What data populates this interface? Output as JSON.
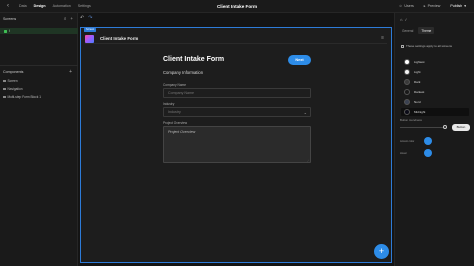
{
  "topbar": {
    "nav": [
      "Data",
      "Design",
      "Automation",
      "Settings"
    ],
    "active_nav": "Design",
    "title": "Client Intake Form",
    "users": "Users",
    "preview": "Preview",
    "publish": "Publish"
  },
  "left": {
    "screens_header": "Screens",
    "screen_item": "/",
    "components_header": "Components",
    "components": [
      "Screen",
      "Navigation",
      "Multi-step Form Block 1"
    ]
  },
  "canvas": {
    "frame_tag": "Screen",
    "app_title": "Client Intake Form",
    "form_title": "Client Intake Form",
    "next_label": "Next",
    "section_title": "Company Information",
    "company_name_label": "Company Name",
    "company_name_placeholder": "Company Name",
    "industry_label": "Industry",
    "industry_value": "Industry",
    "project_label": "Project Overview",
    "project_value": "Project Overview",
    "fab_label": "+"
  },
  "right": {
    "tabs": [
      "General",
      "Theme"
    ],
    "active_tab": "Theme",
    "note": "These settings apply to all screens",
    "themes": [
      {
        "name": "Lightest",
        "color": "#ffffff"
      },
      {
        "name": "Light",
        "color": "#f2f2f2"
      },
      {
        "name": "Dark",
        "color": "#3a3a3a"
      },
      {
        "name": "Darkest",
        "color": "#1a1a1a"
      },
      {
        "name": "Nord",
        "color": "#3b4252"
      },
      {
        "name": "Midnight",
        "color": "#0c0c18"
      }
    ],
    "selected_theme": "Midnight",
    "button_roundness_label": "Button roundness",
    "button_preview": "Button",
    "accent_label": "Accent color",
    "accent_color": "#2d8ce8",
    "hover_label": "Hover",
    "hover_color": "#2d8ce8"
  }
}
